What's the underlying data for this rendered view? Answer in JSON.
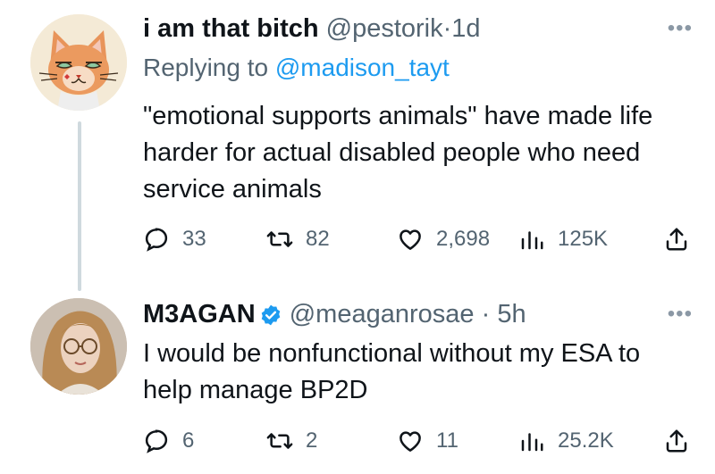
{
  "tweet1": {
    "display_name": "i am that bitch",
    "handle": "@pestorik",
    "separator": "·",
    "time": "1d",
    "more": "•••",
    "reply_prefix": "Replying to ",
    "reply_mention": "@madison_tayt",
    "text": "\"emotional supports animals\" have made life harder for actual disabled people who need service animals",
    "replies": "33",
    "retweets": "82",
    "likes": "2,698",
    "views": "125K"
  },
  "tweet2": {
    "display_name": "M3AGAN",
    "handle": "@meaganrosae",
    "separator": "·",
    "time": "5h",
    "more": "•••",
    "text": "I would be nonfunctional without my ESA to help manage BP2D",
    "replies": "6",
    "retweets": "2",
    "likes": "11",
    "views": "25.2K"
  },
  "colors": {
    "text": "#0f1419",
    "secondary": "#536471",
    "link": "#1d9bf0",
    "thread_line": "#cfd9de",
    "verified": "#1d9bf0"
  }
}
